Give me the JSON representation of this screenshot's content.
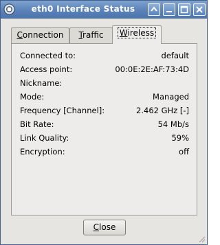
{
  "window": {
    "title": "eth0 Interface Status",
    "controls": [
      "help",
      "minimize",
      "maximize",
      "close"
    ]
  },
  "tabs": [
    {
      "pre": "",
      "mnemonic": "C",
      "post": "onnection",
      "active": false
    },
    {
      "pre": "",
      "mnemonic": "T",
      "post": "raffic",
      "active": false
    },
    {
      "pre": "",
      "mnemonic": "W",
      "post": "ireless",
      "active": true
    }
  ],
  "wireless": {
    "rows": [
      {
        "label": "Connected to:",
        "value": "default"
      },
      {
        "label": "Access point:",
        "value": "00:0E:2E:AF:73:4D"
      },
      {
        "label": "Nickname:",
        "value": ""
      },
      {
        "label": "Mode:",
        "value": "Managed"
      },
      {
        "label": "Frequency [Channel]:",
        "value": "2.462 GHz [-]"
      },
      {
        "label": "Bit Rate:",
        "value": "54 Mb/s"
      },
      {
        "label": "Link Quality:",
        "value": "59%"
      },
      {
        "label": "Encryption:",
        "value": "off"
      }
    ]
  },
  "buttons": {
    "close": {
      "pre": "",
      "mnemonic": "C",
      "post": "lose"
    }
  },
  "colors": {
    "titlebar": "#5b83b9",
    "window_bg": "#e6e5e2",
    "panel_bg": "#edecea"
  }
}
